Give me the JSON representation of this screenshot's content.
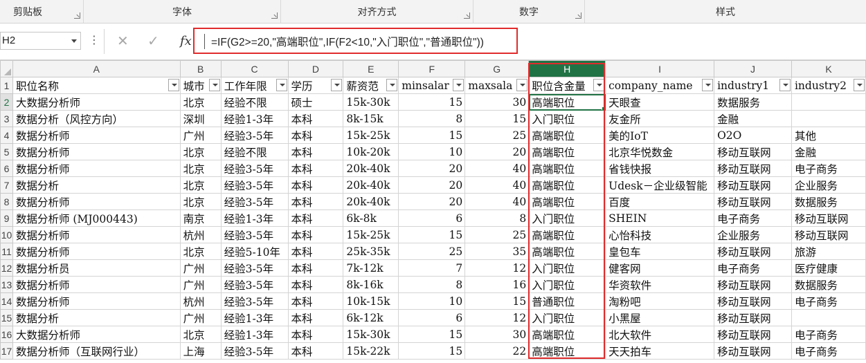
{
  "ribbon": {
    "groups": [
      {
        "label": "剪贴板"
      },
      {
        "label": "字体"
      },
      {
        "label": "对齐方式"
      },
      {
        "label": "数字"
      },
      {
        "label": "样式"
      }
    ]
  },
  "formula_bar": {
    "name_box": "H2",
    "formula": "=IF(G2>=20,\"高端职位\",IF(F2<10,\"入门职位\",\"普通职位\"))"
  },
  "colors": {
    "accent": "#217346",
    "highlight": "#e02b2b"
  },
  "grid": {
    "columns": [
      "A",
      "B",
      "C",
      "D",
      "E",
      "F",
      "G",
      "H",
      "I",
      "J",
      "K"
    ],
    "headers": [
      "职位名称",
      "城市",
      "工作年限",
      "学历",
      "薪资范",
      "minsalar",
      "maxsala",
      "职位含金量",
      "company_name",
      "industry1",
      "industry2"
    ],
    "rows": [
      {
        "n": "2",
        "cells": [
          "大数据分析师",
          "北京",
          "经验不限",
          "硕士",
          "15k-30k",
          "15",
          "30",
          "高端职位",
          "天眼查",
          "数据服务",
          ""
        ]
      },
      {
        "n": "3",
        "cells": [
          "数据分析（风控方向）",
          "深圳",
          "经验1-3年",
          "本科",
          "8k-15k",
          "8",
          "15",
          "入门职位",
          "友金所",
          "金融",
          ""
        ]
      },
      {
        "n": "4",
        "cells": [
          "数据分析师",
          "广州",
          "经验3-5年",
          "本科",
          "15k-25k",
          "15",
          "25",
          "高端职位",
          "美的IoT",
          "O2O",
          "其他"
        ]
      },
      {
        "n": "5",
        "cells": [
          "数据分析师",
          "北京",
          "经验不限",
          "本科",
          "10k-20k",
          "10",
          "20",
          "高端职位",
          "北京华悦数金",
          "移动互联网",
          "金融"
        ]
      },
      {
        "n": "6",
        "cells": [
          "数据分析师",
          "北京",
          "经验3-5年",
          "本科",
          "20k-40k",
          "20",
          "40",
          "高端职位",
          "省钱快报",
          "移动互联网",
          "电子商务"
        ]
      },
      {
        "n": "7",
        "cells": [
          "数据分析",
          "北京",
          "经验3-5年",
          "本科",
          "20k-40k",
          "20",
          "40",
          "高端职位",
          "Udesk－企业级智能",
          "移动互联网",
          "企业服务"
        ]
      },
      {
        "n": "8",
        "cells": [
          "数据分析师",
          "北京",
          "经验3-5年",
          "本科",
          "20k-40k",
          "20",
          "40",
          "高端职位",
          "百度",
          "移动互联网",
          "数据服务"
        ]
      },
      {
        "n": "9",
        "cells": [
          "数据分析师 (MJ000443)",
          "南京",
          "经验1-3年",
          "本科",
          "6k-8k",
          "6",
          "8",
          "入门职位",
          "SHEIN",
          "电子商务",
          "移动互联网"
        ]
      },
      {
        "n": "10",
        "cells": [
          "数据分析师",
          "杭州",
          "经验3-5年",
          "本科",
          "15k-25k",
          "15",
          "25",
          "高端职位",
          "心怡科技",
          "企业服务",
          "移动互联网"
        ]
      },
      {
        "n": "11",
        "cells": [
          "数据分析师",
          "北京",
          "经验5-10年",
          "本科",
          "25k-35k",
          "25",
          "35",
          "高端职位",
          "皇包车",
          "移动互联网",
          "旅游"
        ]
      },
      {
        "n": "12",
        "cells": [
          "数据分析员",
          "广州",
          "经验3-5年",
          "本科",
          "7k-12k",
          "7",
          "12",
          "入门职位",
          "健客网",
          "电子商务",
          "医疗健康"
        ]
      },
      {
        "n": "13",
        "cells": [
          "数据分析师",
          "广州",
          "经验3-5年",
          "本科",
          "8k-16k",
          "8",
          "16",
          "入门职位",
          "华资软件",
          "移动互联网",
          "数据服务"
        ]
      },
      {
        "n": "14",
        "cells": [
          "数据分析师",
          "杭州",
          "经验3-5年",
          "本科",
          "10k-15k",
          "10",
          "15",
          "普通职位",
          "淘粉吧",
          "移动互联网",
          "电子商务"
        ]
      },
      {
        "n": "15",
        "cells": [
          "数据分析",
          "广州",
          "经验1-3年",
          "本科",
          "6k-12k",
          "6",
          "12",
          "入门职位",
          "小黑屋",
          "移动互联网",
          ""
        ]
      },
      {
        "n": "16",
        "cells": [
          "大数据分析师",
          "北京",
          "经验1-3年",
          "本科",
          "15k-30k",
          "15",
          "30",
          "高端职位",
          "北大软件",
          "移动互联网",
          "电子商务"
        ]
      },
      {
        "n": "17",
        "cells": [
          "数据分析师（互联网行业）",
          "上海",
          "经验3-5年",
          "本科",
          "15k-22k",
          "15",
          "22",
          "高端职位",
          "天天拍车",
          "移动互联网",
          "电子商务"
        ]
      }
    ]
  }
}
